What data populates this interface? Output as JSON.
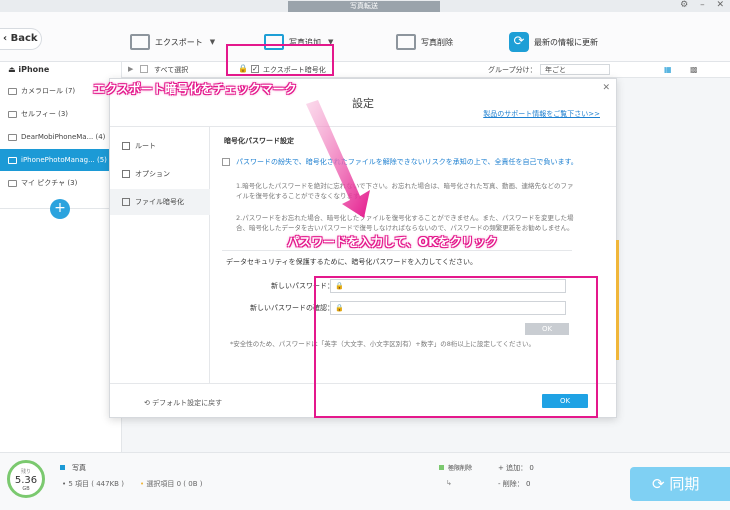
{
  "window": {
    "title": "写真転送"
  },
  "toolbar": {
    "back_label": "Back",
    "export_label": "エクスポート",
    "add_label": "写真追加",
    "delete_label": "写真削除",
    "refresh_label": "最新の情報に更新"
  },
  "subbar": {
    "select_all_label": "すべて選択",
    "encrypt_label": "エクスポート暗号化",
    "group_by_label": "グループ分け：",
    "group_by_value": "年ごと"
  },
  "sidebar": {
    "device": "iPhone",
    "items": [
      {
        "label": "カメラロール (7)",
        "active": false
      },
      {
        "label": "セルフィー (3)",
        "active": false
      },
      {
        "label": "DearMobiPhoneMa... (4)",
        "active": false
      },
      {
        "label": "iPhonePhotoManag... (5)",
        "active": true
      },
      {
        "label": "マイ ピクチャ (3)",
        "active": false
      }
    ],
    "add_symbol": "+"
  },
  "dialog": {
    "title": "設定",
    "close": "✕",
    "support_link": "製品のサポート情報をご覧下さい>>",
    "nav": [
      {
        "label": "ルート"
      },
      {
        "label": "オプション"
      },
      {
        "label": "ファイル暗号化"
      }
    ],
    "section_title": "暗号化パスワード設定",
    "warning": "パスワードの紛失で、暗号化されたファイルを解除できないリスクを承知の上で、全責任を自己で負います。",
    "note1": "1.暗号化したパスワードを絶対に忘れないで下さい。お忘れた場合は、暗号化された写真、動画、連絡先などのファイルを復号化することができなくなります。",
    "note2": "2.パスワードをお忘れた場合、暗号化したファイルを復号化することができません。また、パスワードを変更した場合、暗号化したデータを古いパスワードで復号しなければならないので、パスワードの頻繁更新をお勧めしません。",
    "prompt": "データセキュリティを保護するために、暗号化パスワードを入力してください。",
    "new_password_label": "新しいパスワード：",
    "confirm_password_label": "新しいパスワードの確認：",
    "ok_small": "OK",
    "security_note": "*安全性のため、パスワードは「英字（大文字、小文字区別有）+数字」の8桁以上に設定してください。",
    "default_reset": "デフォルト設定に戻す",
    "ok_label": "OK"
  },
  "status": {
    "storage_label": "残り",
    "storage_value": "5.36",
    "storage_unit": "GB",
    "photo_label": "写真",
    "items_line": "5 項目 ( 447KB )",
    "selected_line": "選択項目 0 ( 0B )",
    "pending_delete": "極限削除",
    "add_count": "追加： 0",
    "delete_count": "削除： 0",
    "sync_label": "同期"
  },
  "annotations": {
    "export_encrypt_tip": "エクスポート暗号化をチェックマーク",
    "password_tip": "パスワードを入力して、OKをクリック"
  },
  "colors": {
    "accent": "#1c9ad6",
    "annotation": "#e4188c"
  }
}
